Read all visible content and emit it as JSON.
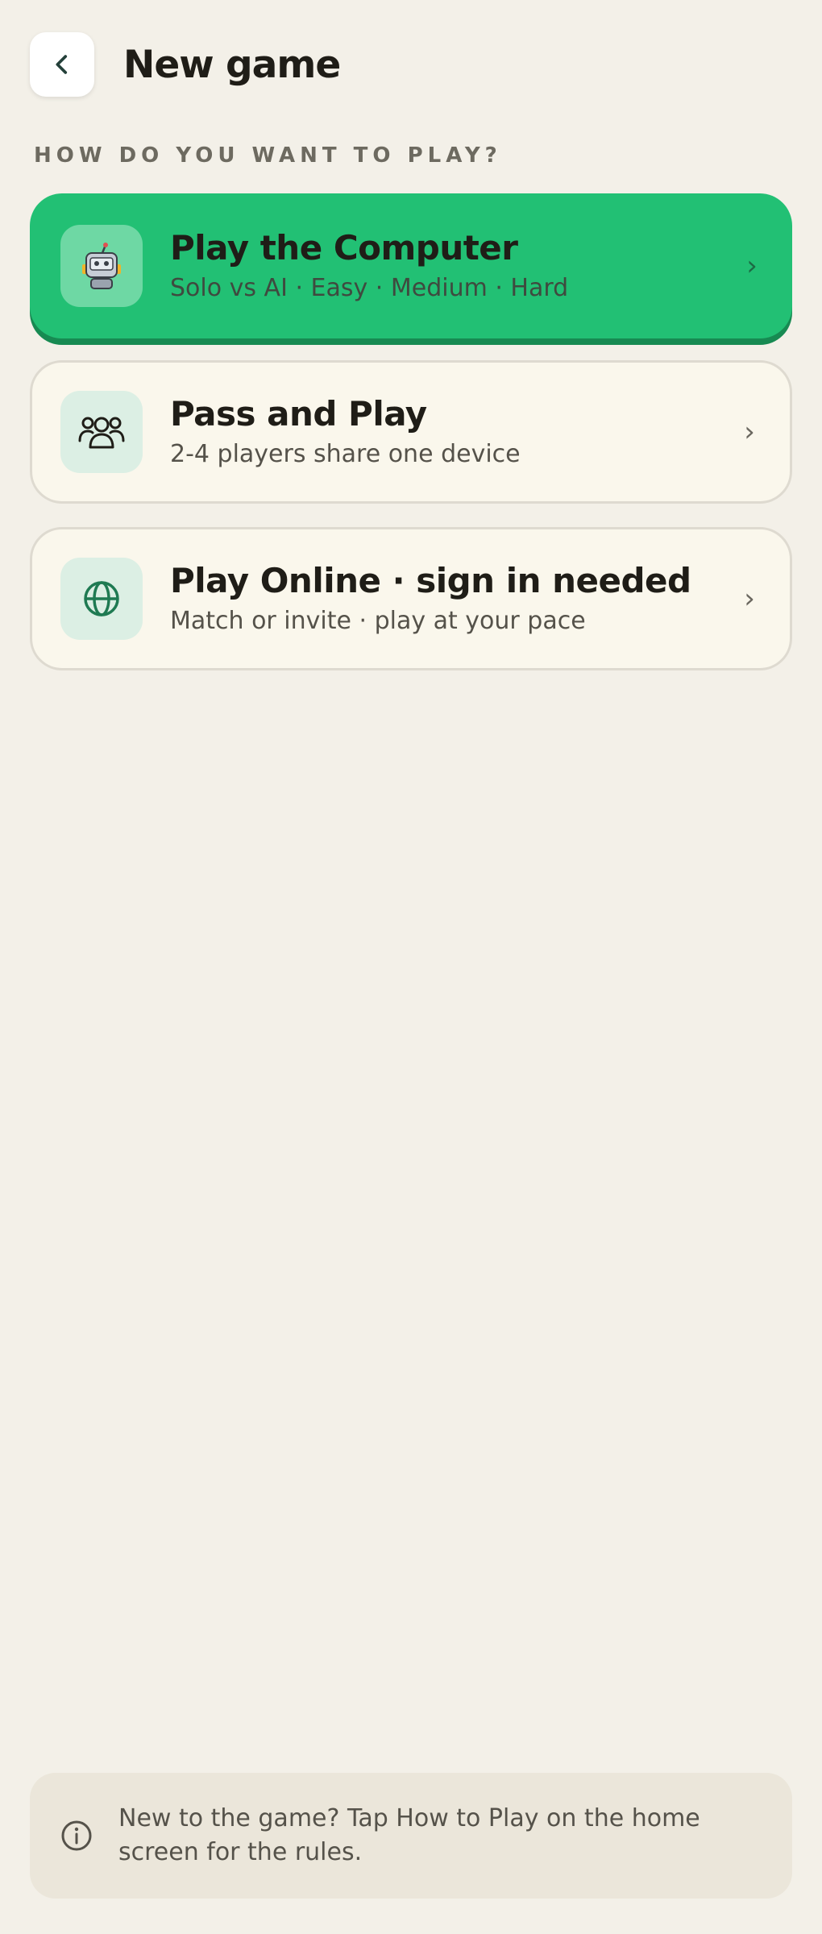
{
  "header": {
    "title": "New game",
    "back_icon": "chevron-left-icon"
  },
  "section": {
    "label": "HOW DO YOU WANT TO PLAY?"
  },
  "options": [
    {
      "title": "Play the Computer",
      "subtitle": "Solo vs AI · Easy · Medium · Hard",
      "icon": "robot-icon",
      "chevron": "›",
      "selected": true
    },
    {
      "title": "Pass and Play",
      "subtitle": "2-4 players share one device",
      "icon": "users-icon",
      "chevron": "›",
      "selected": false
    },
    {
      "title": "Play Online · sign in needed",
      "subtitle": "Match or invite · play at your pace",
      "icon": "globe-icon",
      "chevron": "›",
      "selected": false
    }
  ],
  "info": {
    "icon": "info-icon",
    "text": "New to the game? Tap How to Play on the home screen for the rules."
  },
  "colors": {
    "background": "#f3f0e8",
    "primary_card": "#22c074",
    "primary_card_shadow": "#178a52",
    "secondary_card": "#faf7ec",
    "icon_tile_green": "#dcefe4",
    "accent_dark_green": "#1f7a52"
  }
}
